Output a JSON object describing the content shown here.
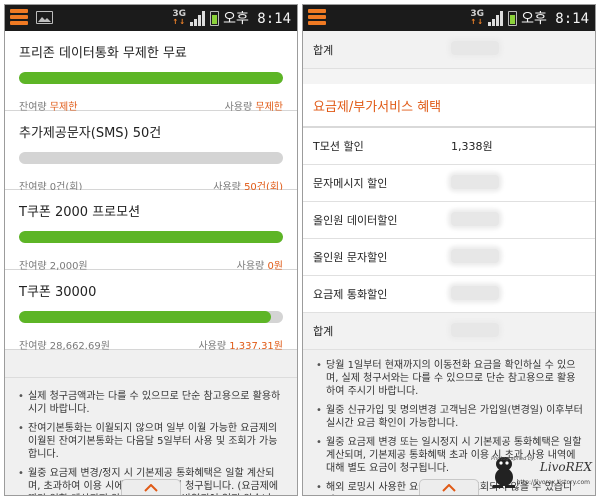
{
  "status": {
    "network": "3G",
    "network_arrows": "↑↓",
    "clock": "오후 8:14"
  },
  "left": {
    "items": [
      {
        "title": "프리존 데이터통화 무제한 무료",
        "remain_label": "잔여량",
        "remain_value": "무제한",
        "used_label": "사용량",
        "used_value": "무제한",
        "progress": 1.0
      },
      {
        "title": "추가제공문자(SMS) 50건",
        "remain_label": "잔여량",
        "remain_value": "0건(회)",
        "used_label": "사용량",
        "used_value": "50건(회)",
        "progress": 0.0
      },
      {
        "title": "T쿠폰 2000 프로모션",
        "remain_label": "잔여량",
        "remain_value": "2,000원",
        "used_label": "사용량",
        "used_value": "0원",
        "progress": 1.0
      },
      {
        "title": "T쿠폰 30000",
        "remain_label": "잔여량",
        "remain_value": "28,662.69원",
        "used_label": "사용량",
        "used_value": "1,337.31원",
        "progress": 0.955
      }
    ],
    "notes": [
      "실제 청구금액과는 다를 수 있으므로 단순 참고용으로 활용하시기 바랍니다.",
      "잔여기본통화는 이월되지 않으며 일부 이월 가능한 요금제의 이월된 잔여기본통화는 다음달 5일부터 사용 및 조회가 가능합니다.",
      "월중 요금제 변경/정지 시 기본제공 통화혜택은 일할 계산되며, 초과하여 이용 시에는 추가요금이 청구됩니다. (요금제에 따라 일할 계산되지 않는 통화혜택은 반영되어 있지 않습니다.)"
    ]
  },
  "right": {
    "top_total_label": "합계",
    "section_title": "요금제/부가서비스 혜택",
    "rows": [
      {
        "label": "T모션 할인",
        "value": "1,338원"
      },
      {
        "label": "문자메시지 할인",
        "value": ""
      },
      {
        "label": "올인원 데이터할인",
        "value": ""
      },
      {
        "label": "올인원 문자할인",
        "value": ""
      },
      {
        "label": "요금제 통화할인",
        "value": ""
      }
    ],
    "bottom_total_label": "합계",
    "notes": [
      "당월 1일부터 현재까지의 이동전화 요금을 확인하실 수 있으며, 실제 청구서와는 다를 수 있으므로 단순 참고용으로 활용하여 주시기 바랍니다.",
      "월중 신규가입 및 명의변경 고객님은 가입일(변경일) 이후부터 실시간 요금 확인이 가능합니다.",
      "월중 요금제 변경 또는 일시정지 시 기본제공 통화혜택은 일할 계산되며, 기본제공 통화혜택 초과 이용 시 초과 사용 내역에 대해 별도 요금이 청구됩니다.",
      "해외 로밍시 사용한 요금은 실시간 조회되지 않을 수 있습니다."
    ]
  },
  "watermark": {
    "by": "Photographed by",
    "name": "LivoREX",
    "url": "http://livorex.tistory.com"
  },
  "colors": {
    "accent": "#e05a16",
    "progress": "#5db526",
    "statusbar": "#1b1b1b"
  }
}
